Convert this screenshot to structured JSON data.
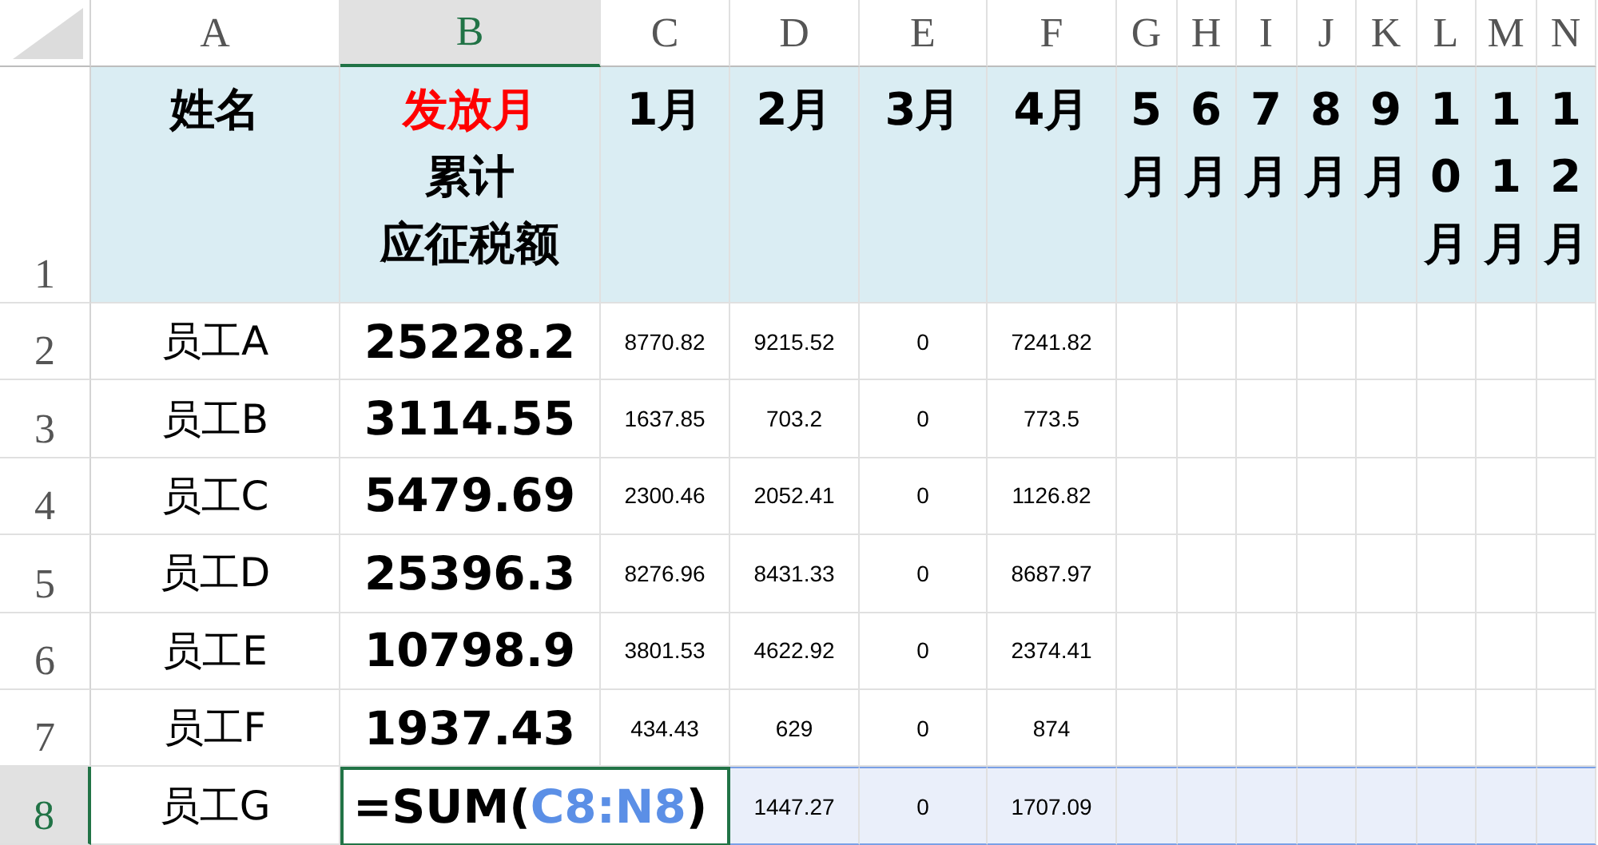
{
  "columns": [
    {
      "label": "A",
      "selected": false
    },
    {
      "label": "B",
      "selected": true
    },
    {
      "label": "C",
      "selected": false
    },
    {
      "label": "D",
      "selected": false
    },
    {
      "label": "E",
      "selected": false
    },
    {
      "label": "F",
      "selected": false
    },
    {
      "label": "G",
      "selected": false
    },
    {
      "label": "H",
      "selected": false
    },
    {
      "label": "I",
      "selected": false
    },
    {
      "label": "J",
      "selected": false
    },
    {
      "label": "K",
      "selected": false
    },
    {
      "label": "L",
      "selected": false
    },
    {
      "label": "M",
      "selected": false
    },
    {
      "label": "N",
      "selected": false
    }
  ],
  "header_row": {
    "number": "1",
    "selected": false,
    "name": "姓名",
    "total_lines": [
      {
        "text": "发放月",
        "emphasis": true
      },
      {
        "text": "累计",
        "emphasis": false
      },
      {
        "text": "应征税额",
        "emphasis": false
      }
    ],
    "months": [
      "1月",
      "2月",
      "3月",
      "4月",
      "5月",
      "6月",
      "7月",
      "8月",
      "9月",
      "10月",
      "11月",
      "12月"
    ]
  },
  "rows": [
    {
      "number": "2",
      "selected": false,
      "name": "员工A",
      "total": "25228.2",
      "months": [
        "8770.82",
        "9215.52",
        "0",
        "7241.82"
      ]
    },
    {
      "number": "3",
      "selected": false,
      "name": "员工B",
      "total": "3114.55",
      "months": [
        "1637.85",
        "703.2",
        "0",
        "773.5"
      ]
    },
    {
      "number": "4",
      "selected": false,
      "name": "员工C",
      "total": "5479.69",
      "months": [
        "2300.46",
        "2052.41",
        "0",
        "1126.82"
      ]
    },
    {
      "number": "5",
      "selected": false,
      "name": "员工D",
      "total": "25396.3",
      "months": [
        "8276.96",
        "8431.33",
        "0",
        "8687.97"
      ]
    },
    {
      "number": "6",
      "selected": false,
      "name": "员工E",
      "total": "10798.9",
      "months": [
        "3801.53",
        "4622.92",
        "0",
        "2374.41"
      ]
    },
    {
      "number": "7",
      "selected": false,
      "name": "员工F",
      "total": "1937.43",
      "months": [
        "434.43",
        "629",
        "0",
        "874"
      ]
    },
    {
      "number": "8",
      "selected": true,
      "name": "员工G",
      "editing": {
        "prefix": "=SUM(",
        "ref": "C8:N8",
        "suffix": ")"
      },
      "months": [
        "1447.27",
        "0",
        "1707.09"
      ]
    }
  ]
}
